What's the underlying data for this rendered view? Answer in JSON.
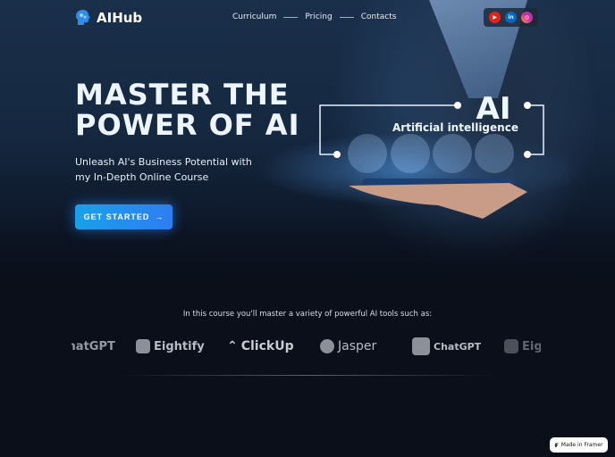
{
  "header": {
    "logo_text": "AIHub",
    "nav": [
      "Curriculum",
      "Pricing",
      "Contacts"
    ],
    "social": [
      {
        "icon": "youtube-icon",
        "color": "#e62117"
      },
      {
        "icon": "linkedin-icon",
        "color": "#0a66c2"
      },
      {
        "icon": "instagram-icon",
        "color": "#d62f9a"
      }
    ]
  },
  "hero": {
    "title_line1": "MASTER THE",
    "title_line2": "POWER OF AI",
    "subtitle_line1": "Unleash AI's Business Potential with",
    "subtitle_line2": "my In-Depth Online Course",
    "cta": "GET STARTED",
    "cta_icon": "arrow-right-icon",
    "graphic": {
      "big": "AI",
      "caption": "Artificial intelligence"
    }
  },
  "tools": {
    "tagline": "In this course you'll master a variety of powerful AI tools such as:",
    "items": [
      "ChatGPT",
      "Eightify",
      "ClickUp",
      "Jasper",
      "ChatGPT",
      "Eightify"
    ]
  },
  "badge": {
    "label": "Made in Framer"
  },
  "colors": {
    "accent": "#1aa0ea",
    "background": "#0a0f1a"
  }
}
